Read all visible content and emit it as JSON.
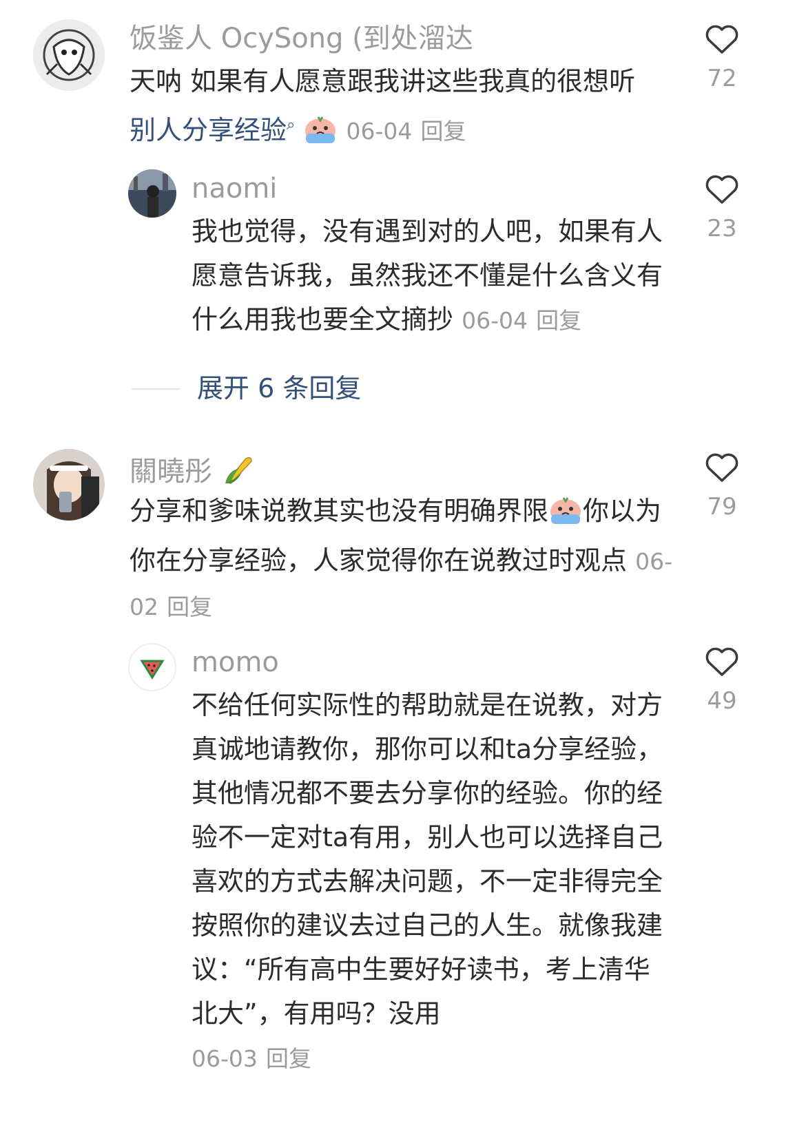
{
  "comments": [
    {
      "username": "饭鉴人 OcySong (到处溜达",
      "text": "天呐 如果有人愿意跟我讲这些我真的很想听",
      "link": "别人分享经验",
      "date": "06-04",
      "reply": "回复",
      "likes": "72"
    },
    {
      "username": "naomi",
      "text": "我也觉得，没有遇到对的人吧，如果有人愿意告诉我，虽然我还不懂是什么含义有什么用我也要全文摘抄",
      "date": "06-04",
      "reply": "回复",
      "likes": "23"
    },
    {
      "username": "關曉彤",
      "text_a": "分享和爹味说教其实也没有明确界限",
      "text_b": "你以为你在分享经验，人家觉得你在说教过时观点",
      "date": "06-02",
      "reply": "回复",
      "likes": "79"
    },
    {
      "username": "momo",
      "text": "不给任何实际性的帮助就是在说教，对方真诚地请教你，那你可以和ta分享经验，其他情况都不要去分享你的经验。你的经验不一定对ta有用，别人也可以选择自己喜欢的方式去解决问题，不一定非得完全按照你的建议去过自己的人生。就像我建议：“所有高中生要好好读书，考上清华北大”，有用吗？没用",
      "date": "06-03",
      "reply": "回复",
      "likes": "49"
    }
  ],
  "expand_replies": "展开 6 条回复",
  "colors": {
    "meta": "#9b9b9b",
    "link": "#33507a",
    "text": "#2b2b2b"
  }
}
